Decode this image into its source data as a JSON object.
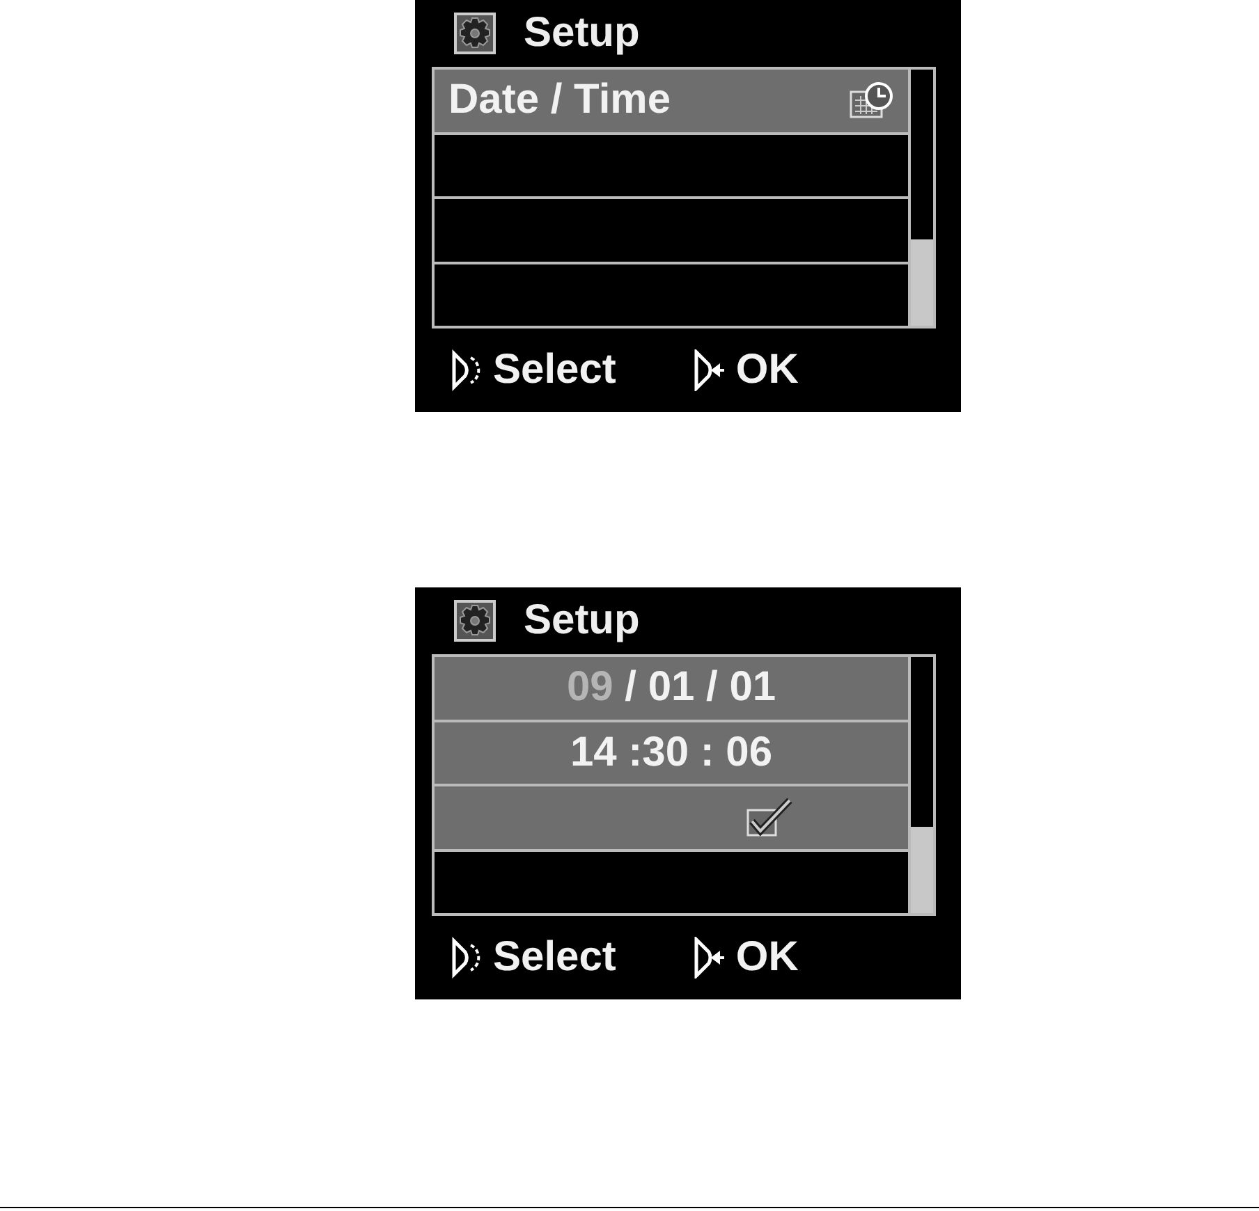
{
  "screens": [
    {
      "title": "Setup",
      "rows": [
        {
          "kind": "label",
          "text": "Date / Time",
          "selected": true
        },
        {
          "kind": "empty",
          "selected": false
        },
        {
          "kind": "empty",
          "selected": false
        },
        {
          "kind": "empty",
          "selected": false
        }
      ],
      "footer": [
        {
          "kind": "select",
          "text": "Select"
        },
        {
          "kind": "ok",
          "text": "OK"
        }
      ]
    },
    {
      "title": "Setup",
      "rows": [
        {
          "kind": "fields",
          "selected": true,
          "parts": [
            {
              "text": "09",
              "active": true
            },
            {
              "text": " / 01 / 01",
              "active": false
            }
          ]
        },
        {
          "kind": "fields",
          "selected": true,
          "parts": [
            {
              "text": "14 :30 : 06",
              "active": false
            }
          ]
        },
        {
          "kind": "checkbox",
          "selected": true,
          "checked": true
        },
        {
          "kind": "empty",
          "selected": false
        }
      ],
      "footer": [
        {
          "kind": "select",
          "text": "Select"
        },
        {
          "kind": "ok",
          "text": "OK"
        }
      ]
    }
  ]
}
